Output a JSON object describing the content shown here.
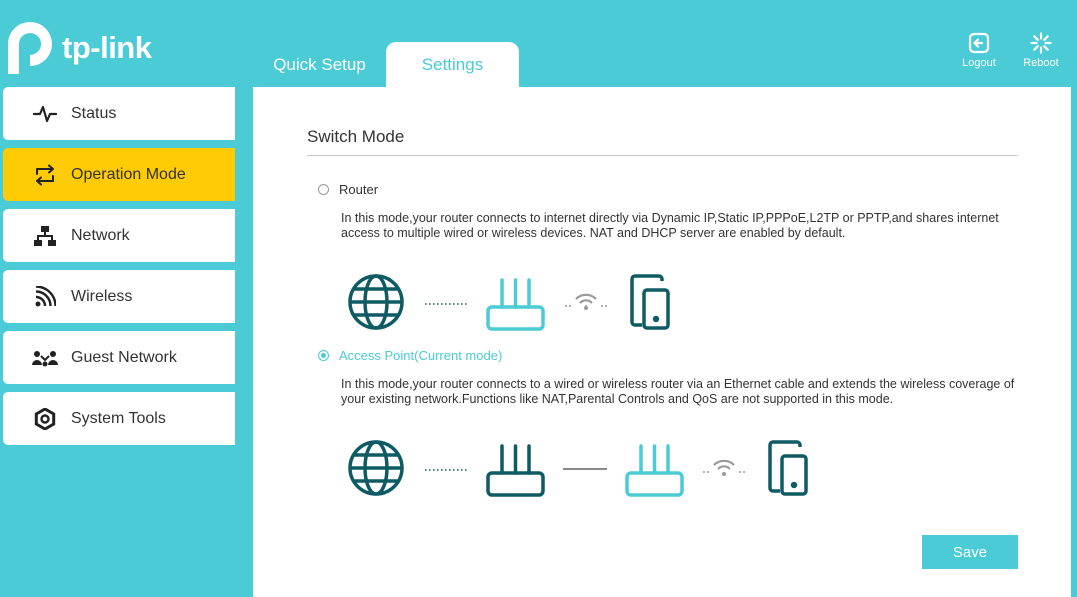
{
  "brand": {
    "name": "tp-link"
  },
  "tabs": [
    {
      "label": "Quick Setup",
      "active": false
    },
    {
      "label": "Settings",
      "active": true
    }
  ],
  "top_actions": {
    "logout_label": "Logout",
    "reboot_label": "Reboot"
  },
  "sidebar": {
    "items": [
      {
        "label": "Status",
        "icon": "pulse-icon",
        "active": false
      },
      {
        "label": "Operation Mode",
        "icon": "switch-arrows-icon",
        "active": true
      },
      {
        "label": "Network",
        "icon": "network-icon",
        "active": false
      },
      {
        "label": "Wireless",
        "icon": "wireless-icon",
        "active": false
      },
      {
        "label": "Guest Network",
        "icon": "guest-icon",
        "active": false
      },
      {
        "label": "System Tools",
        "icon": "gear-icon",
        "active": false
      }
    ]
  },
  "main": {
    "title": "Switch Mode",
    "modes": [
      {
        "label": "Router",
        "selected": false,
        "description": "In this mode,your router connects to internet directly via Dynamic IP,Static IP,PPPoE,L2TP or PPTP,and shares internet access to multiple wired or wireless devices. NAT and DHCP server are enabled by default.",
        "diagram": [
          "globe-icon",
          "dotted-line",
          "router-icon",
          "wifi-icon",
          "mobile-device-icon"
        ]
      },
      {
        "label": "Access Point(Current mode)",
        "selected": true,
        "description": "In this mode,your router connects to a wired or wireless router via an Ethernet cable and extends the wireless coverage of your existing network.Functions like NAT,Parental Controls and QoS are not supported in this mode.",
        "diagram": [
          "globe-icon",
          "dotted-line",
          "router-icon",
          "cable-line",
          "router-icon",
          "wifi-icon",
          "mobile-device-icon"
        ]
      }
    ],
    "save_label": "Save"
  },
  "colors": {
    "accent": "#4acbd6",
    "active_nav": "#ffcb05",
    "icon_dark": "#0e5b63",
    "icon_light": "#4acbd6"
  }
}
